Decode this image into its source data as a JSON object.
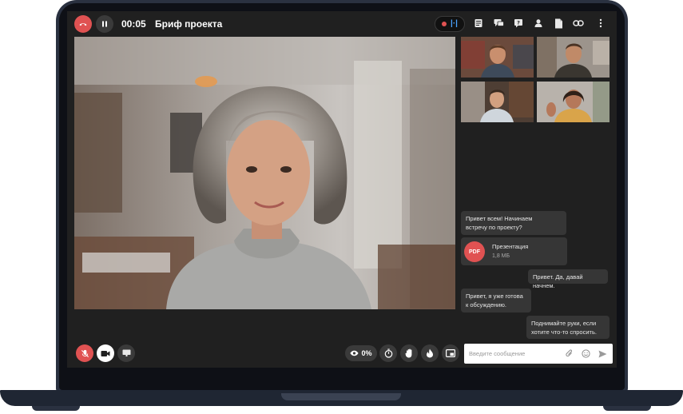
{
  "call": {
    "timer": "00:05",
    "title": "Бриф проекта"
  },
  "chat": {
    "messages": [
      {
        "text_line1": "Привет всем! Начинаем",
        "text_line2": "встречу по проекту?"
      },
      {
        "text": "Привет. Да, давай начнем."
      },
      {
        "text_line1": "Привет, я уже готова",
        "text_line2": "к обсуждению."
      },
      {
        "text_line1": "Поднимайте руки, если",
        "text_line2": "хотите что-то спросить."
      }
    ],
    "file": {
      "badge": "PDF",
      "name": "Презентация",
      "size": "1,8 МБ"
    },
    "input_placeholder": "Введите сообщение"
  },
  "controls": {
    "viewers_percent": "0%"
  },
  "colors": {
    "danger": "#e05252",
    "accent_blue": "#4aa3ff",
    "panel": "#202020",
    "bubble": "#363636"
  }
}
